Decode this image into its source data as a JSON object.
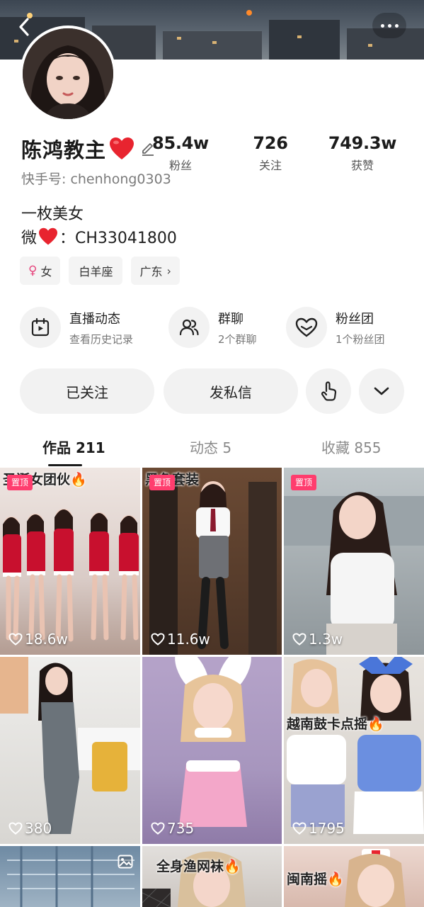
{
  "profile": {
    "name": "陈鸿教主",
    "uid": "快手号: chenhong0303",
    "bio_line1": "一枚美女",
    "bio_line2_prefix": "微",
    "bio_line2_suffix": "：CH33041800"
  },
  "stats": [
    {
      "value": "85.4w",
      "label": "粉丝"
    },
    {
      "value": "726",
      "label": "关注"
    },
    {
      "value": "749.3w",
      "label": "获赞"
    }
  ],
  "tags": [
    {
      "icon": "female-icon",
      "label": "女"
    },
    {
      "label": "白羊座"
    },
    {
      "label": "广东",
      "chevron": "›"
    }
  ],
  "features": [
    {
      "icon": "calendar-play-icon",
      "title": "直播动态",
      "subtitle": "查看历史记录"
    },
    {
      "icon": "group-chat-icon",
      "title": "群聊",
      "subtitle": "2个群聊"
    },
    {
      "icon": "fan-club-heart-icon",
      "title": "粉丝团",
      "subtitle": "1个粉丝团"
    }
  ],
  "actions": {
    "follow_label": "已关注",
    "message_label": "发私信",
    "gesture_icon": "tap-hand-icon",
    "expand_icon": "chevron-down-icon"
  },
  "tabs": [
    {
      "label": "作品 211",
      "active": true
    },
    {
      "label": "动态 5",
      "active": false
    },
    {
      "label": "收藏 855",
      "active": false
    }
  ],
  "videos": [
    {
      "caption": "圣诞女团伙🔥",
      "pinned": "置顶",
      "likes": "18.6w"
    },
    {
      "caption": "黑色套装",
      "pinned": "置顶",
      "likes": "11.6w"
    },
    {
      "caption": "",
      "pinned": "置顶",
      "likes": "1.3w"
    },
    {
      "caption": "",
      "pinned": "",
      "likes": "380"
    },
    {
      "caption": "",
      "pinned": "",
      "likes": "735"
    },
    {
      "caption": "越南鼓卡点摇🔥",
      "pinned": "",
      "likes": "1795"
    },
    {
      "caption": "",
      "pinned": "",
      "likes": ""
    },
    {
      "caption": "全身渔网袜🔥",
      "pinned": "",
      "likes": ""
    },
    {
      "caption": "闽南摇🔥",
      "pinned": "",
      "likes": ""
    }
  ],
  "colors": {
    "heart": "#e8242f",
    "pin_badge": "#ff3d6e",
    "female_symbol": "#e6447c",
    "button_bg": "#f2f2f2"
  }
}
